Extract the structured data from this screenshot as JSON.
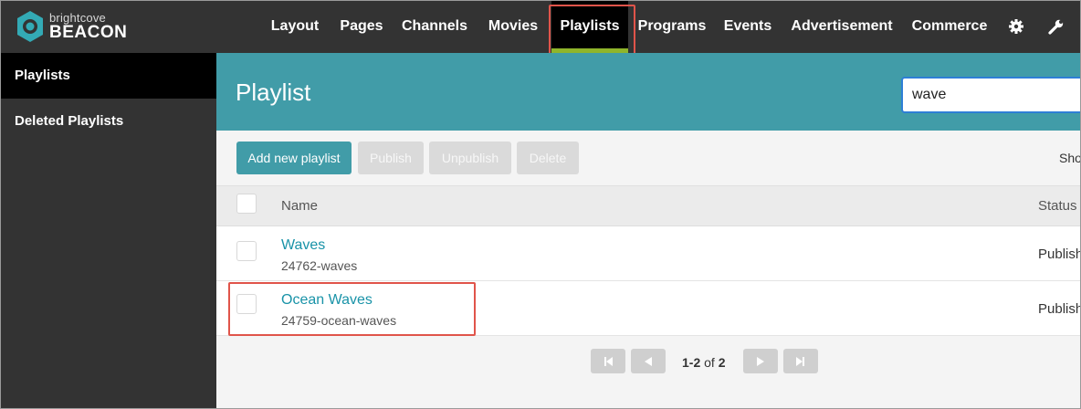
{
  "brand": {
    "small": "brightcove",
    "big": "BEACON"
  },
  "nav": {
    "items": [
      "Layout",
      "Pages",
      "Channels",
      "Movies",
      "Playlists",
      "Programs",
      "Events",
      "Advertisement",
      "Commerce"
    ],
    "active": "Playlists",
    "icons": [
      "gear-icon",
      "wrench-icon"
    ]
  },
  "sidebar": {
    "items": [
      "Playlists",
      "Deleted Playlists"
    ],
    "active": "Playlists"
  },
  "header": {
    "title": "Playlist"
  },
  "search": {
    "value": "wave"
  },
  "toolbar": {
    "add_label": "Add new playlist",
    "publish_label": "Publish",
    "unpublish_label": "Unpublish",
    "delete_label": "Delete",
    "show_label": "Sho"
  },
  "table": {
    "headers": {
      "name": "Name",
      "status": "Status"
    },
    "rows": [
      {
        "title": "Waves",
        "slug": "24762-waves",
        "status": "Publish"
      },
      {
        "title": "Ocean Waves",
        "slug": "24759-ocean-waves",
        "status": "Publish"
      }
    ]
  },
  "pagination": {
    "range": "1-2",
    "of": "of",
    "total": "2"
  },
  "colors": {
    "accent": "#419ca8",
    "nav_bg": "#333333",
    "active_underline": "#8fb52b",
    "link": "#1993a8",
    "highlight": "#e0544a"
  }
}
